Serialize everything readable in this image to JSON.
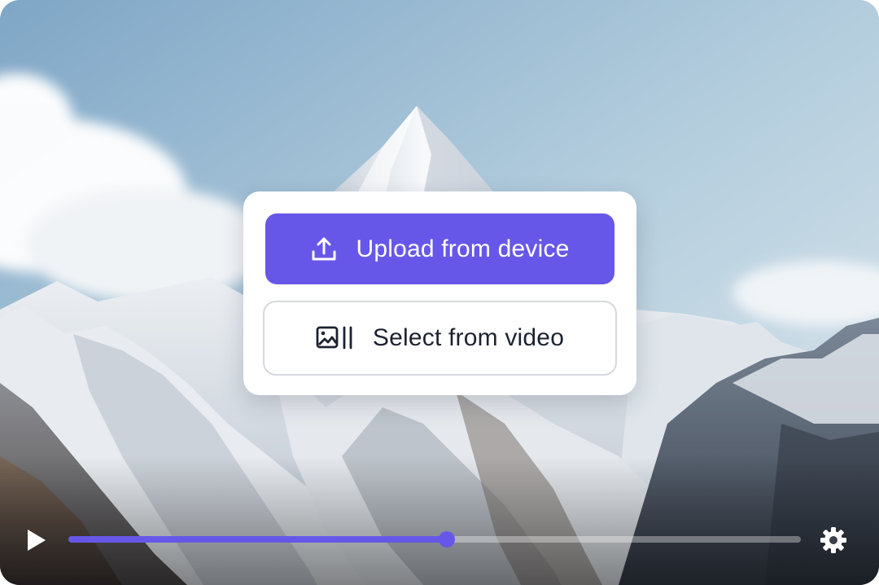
{
  "menu": {
    "upload_label": "Upload from device",
    "upload_icon": "upload-icon",
    "select_label": "Select from video",
    "select_icon": "select-frame-icon"
  },
  "player": {
    "progress": 0.517,
    "play_icon": "play-icon",
    "settings_icon": "gear-icon"
  },
  "colors": {
    "accent": "#6757e8",
    "select_text": "#1c2230",
    "select_border": "#d5d8de"
  }
}
